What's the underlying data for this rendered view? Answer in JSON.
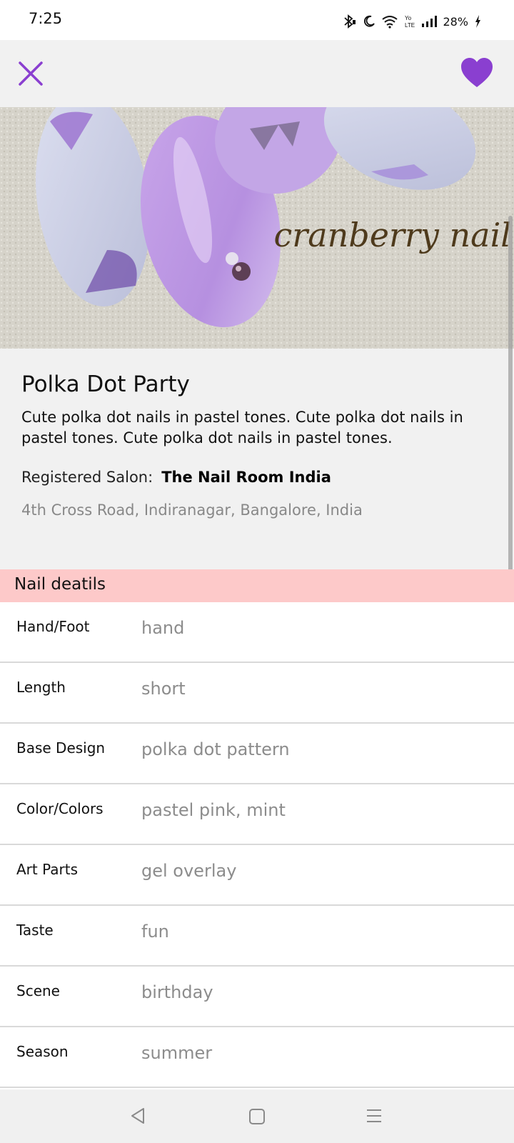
{
  "status": {
    "time": "7:25",
    "battery": "28%"
  },
  "hero": {
    "watermark": "cranberry nail"
  },
  "design": {
    "title": "Polka Dot Party",
    "description": "Cute polka dot nails in pastel tones. Cute polka dot nails in pastel tones. Cute polka dot nails in pastel tones.",
    "salon_label": "Registered Salon:",
    "salon_name": "The Nail Room India",
    "address": "4th Cross Road, Indiranagar, Bangalore, India"
  },
  "details": {
    "header": "Nail deatils",
    "rows": [
      {
        "label": "Hand/Foot",
        "value": "hand"
      },
      {
        "label": "Length",
        "value": "short"
      },
      {
        "label": "Base Design",
        "value": "polka dot pattern"
      },
      {
        "label": "Color/Colors",
        "value": "pastel pink, mint"
      },
      {
        "label": "Art Parts",
        "value": "gel overlay"
      },
      {
        "label": "Taste",
        "value": "fun"
      },
      {
        "label": "Scene",
        "value": "birthday"
      },
      {
        "label": "Season",
        "value": "summer"
      }
    ]
  },
  "colors": {
    "accent": "#8a3fd0",
    "section_header_bg": "#fdc9c9"
  },
  "icons": {
    "close": "close-icon",
    "favorite": "heart-icon",
    "back": "back-icon",
    "home": "home-icon",
    "menu": "menu-icon"
  }
}
